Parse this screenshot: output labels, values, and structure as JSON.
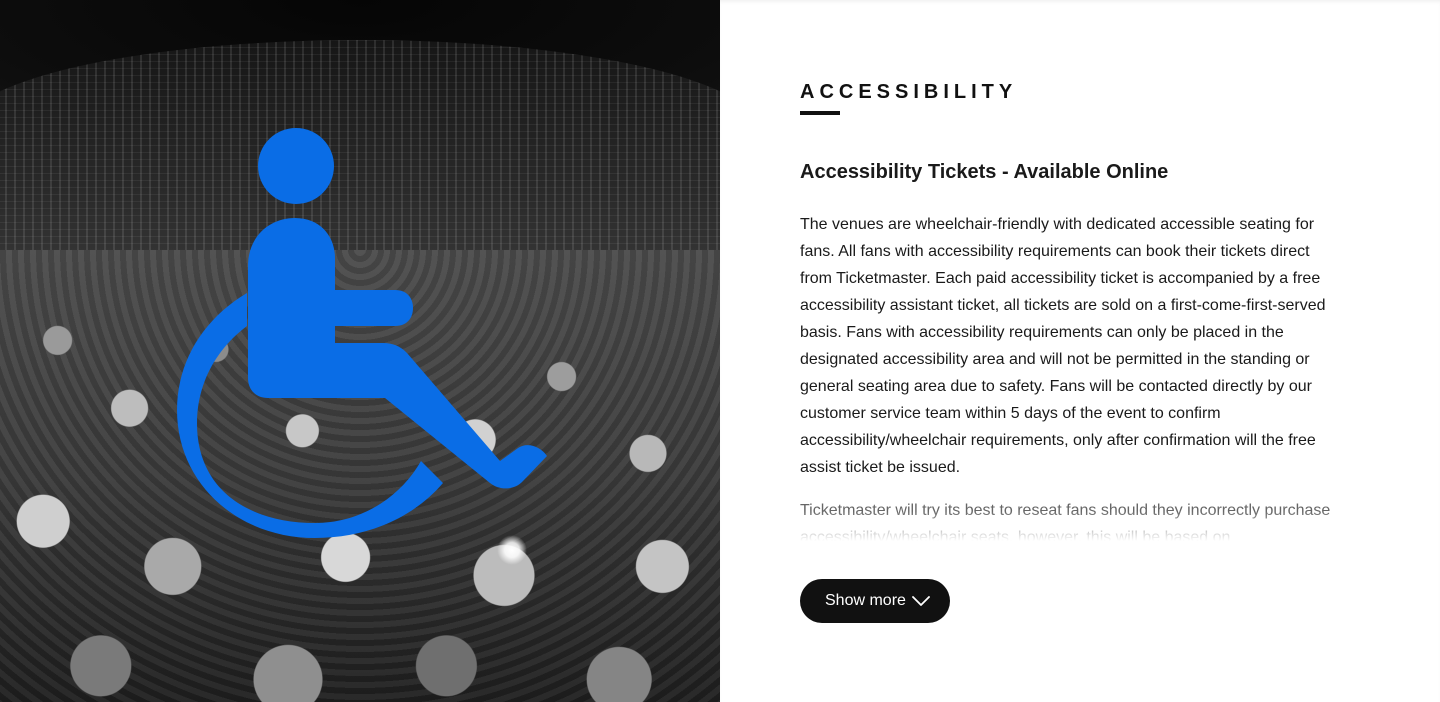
{
  "hero": {
    "icon": "wheelchair-icon",
    "icon_color": "#0a6de6"
  },
  "section": {
    "heading": "ACCESSIBILITY",
    "subtitle": "Accessibility Tickets - Available Online",
    "paragraph_1": "The venues are wheelchair-friendly with dedicated accessible seating for fans. All fans with accessibility requirements can book their tickets direct from Ticketmaster. Each paid accessibility ticket is accompanied by a free accessibility assistant ticket, all tickets are sold on a first-come-first-served basis. Fans with accessibility requirements can only be placed in the designated accessibility area and will not be permitted in the standing or general seating area due to safety. Fans will be contacted directly by our customer service team within 5 days of the event to confirm accessibility/wheelchair requirements, only after confirmation will the free assist ticket be issued.",
    "paragraph_2": "Ticketmaster will try its best to reseat fans should they incorrectly purchase accessibility/wheelchair seats, however, this will be based on"
  },
  "actions": {
    "show_more_label": "Show more",
    "show_more_icon": "chevron-down-icon"
  },
  "colors": {
    "accent": "#0a6de6",
    "button_bg": "#111111",
    "text": "#1a1a1a"
  }
}
